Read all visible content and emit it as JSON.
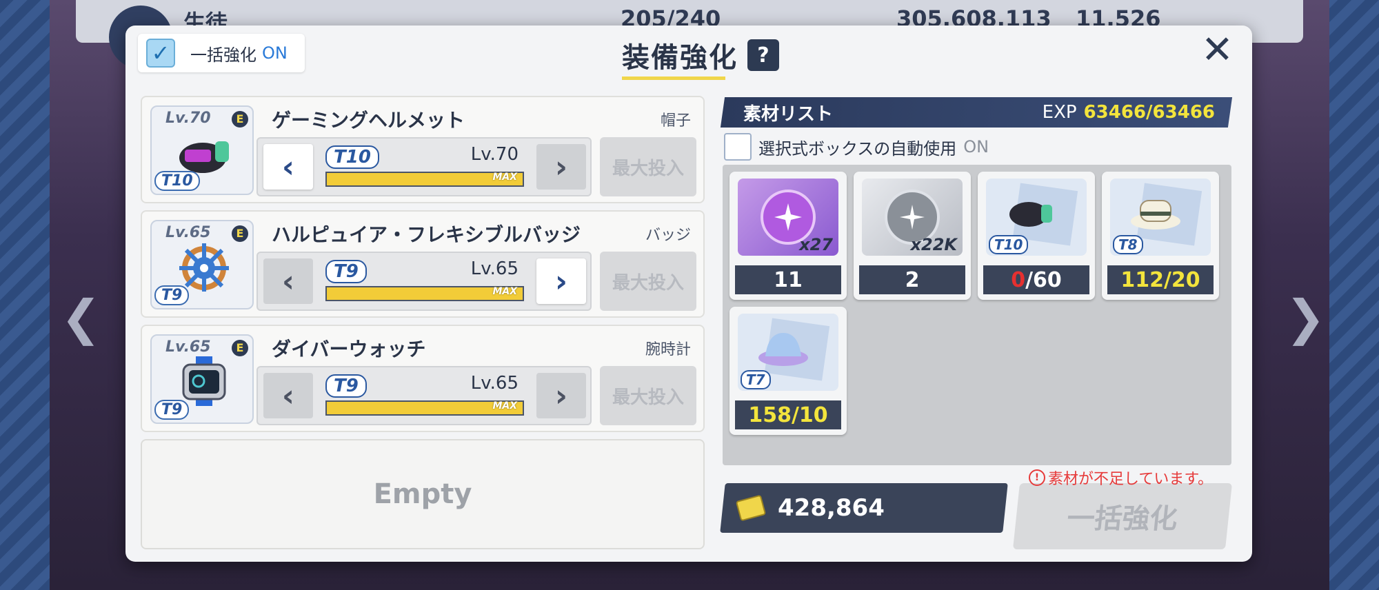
{
  "topbar": {
    "title": "生徒",
    "stamina": "205/240",
    "credits": "305,608,113",
    "gems": "11,526"
  },
  "header": {
    "bulk_label": "一括強化",
    "bulk_state": "ON",
    "title": "装備強化",
    "help": "?",
    "close": "✕"
  },
  "equipment": [
    {
      "name": "ゲーミングヘルメット",
      "slot": "帽子",
      "lv_badge": "Lv.70",
      "rank": "E",
      "tier": "T10",
      "level": "Lv.70",
      "max": "MAX",
      "max_invest": "最大投入"
    },
    {
      "name": "ハルピュイア・フレキシブルバッジ",
      "slot": "バッジ",
      "lv_badge": "Lv.65",
      "rank": "E",
      "tier": "T9",
      "level": "Lv.65",
      "max": "MAX",
      "max_invest": "最大投入"
    },
    {
      "name": "ダイバーウォッチ",
      "slot": "腕時計",
      "lv_badge": "Lv.65",
      "rank": "E",
      "tier": "T9",
      "level": "Lv.65",
      "max": "MAX",
      "max_invest": "最大投入"
    }
  ],
  "empty_label": "Empty",
  "materials": {
    "title": "素材リスト",
    "exp_label": "EXP",
    "exp_value": "63466/63466",
    "auto_box_label": "選択式ボックスの自動使用",
    "auto_box_state": "ON",
    "items": [
      {
        "qty": "x27",
        "count": "11",
        "icon": "purple-orb-icon"
      },
      {
        "qty": "x22K",
        "count": "2",
        "icon": "silver-orb-icon"
      },
      {
        "tier": "T10",
        "count_owned": "0",
        "count_need": "/60",
        "icon": "helmet-blueprint-icon"
      },
      {
        "tier": "T8",
        "count": "112/20",
        "icon": "hat-blueprint-icon"
      },
      {
        "tier": "T7",
        "count": "158/10",
        "icon": "bucket-hat-blueprint-icon"
      }
    ]
  },
  "cost": "428,864",
  "warning": "素材が不足しています。",
  "bulk_button": "一括強化",
  "colors": {
    "accent": "#2a7ad8",
    "panel": "#3a4459",
    "highlight": "#f3e43c",
    "warning": "#e63a3a"
  }
}
